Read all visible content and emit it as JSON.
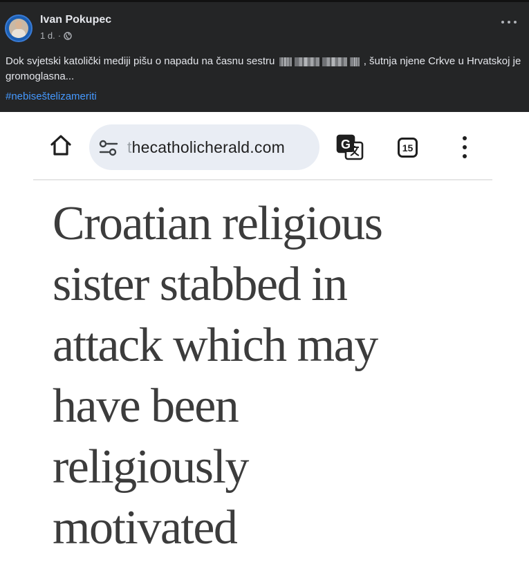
{
  "post": {
    "author": "Ivan Pokupec",
    "time": "1 d.",
    "separator": "·",
    "privacy_icon": "globe-icon",
    "more_icon": "more-options-icon",
    "text_before": "Dok svjetski katolički mediji pišu o napadu na časnu sestru",
    "text_after": ", šutnja njene Crkve u Hrvatskoj je gromoglasna...",
    "hashtag": "#nebiseštelizameriti",
    "colors": {
      "background": "#242526",
      "text": "#e4e6eb",
      "hashtag": "#4599ff"
    }
  },
  "browser": {
    "url_prefix_faded": "t",
    "url": "hecatholicherald.com",
    "tab_count": "15",
    "icons": [
      "home-icon",
      "site-settings-icon",
      "translate-icon",
      "tabs-icon",
      "menu-icon"
    ],
    "colors": {
      "url_bar": "#e9edf4"
    }
  },
  "article": {
    "headline_lines": [
      "Croatian religious",
      "sister stabbed in",
      "attack which may",
      "have been",
      "religiously",
      "motivated"
    ]
  }
}
